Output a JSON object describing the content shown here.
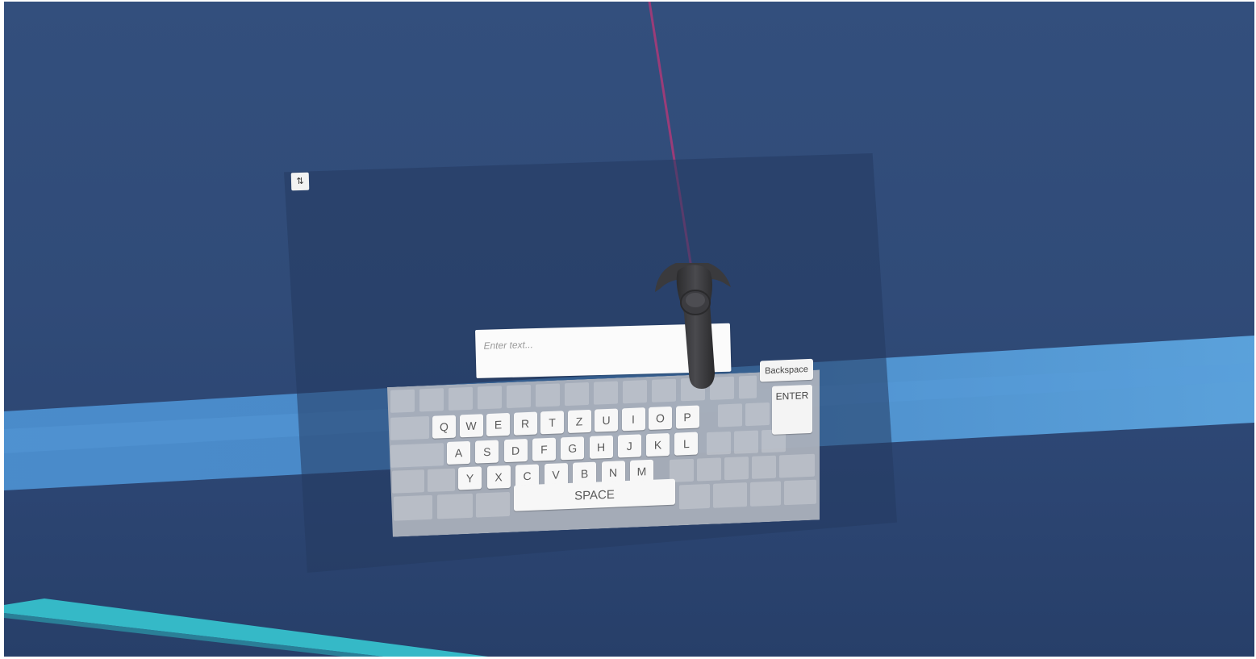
{
  "panel": {
    "sort_icon": "sort-arrows-icon",
    "sort_glyph": "⇅"
  },
  "input": {
    "placeholder": "Enter text...",
    "value": ""
  },
  "keyboard": {
    "row1": [
      "Q",
      "W",
      "E",
      "R",
      "T",
      "Z",
      "U",
      "I",
      "O",
      "P"
    ],
    "row2": [
      "A",
      "S",
      "D",
      "F",
      "G",
      "H",
      "J",
      "K",
      "L"
    ],
    "row3": [
      "Y",
      "X",
      "C",
      "V",
      "B",
      "N",
      "M"
    ],
    "backspace": "Backspace",
    "enter": "ENTER",
    "space": "SPACE"
  },
  "controller": {
    "icon": "vr-controller-icon",
    "laser_color": "#9a3c78"
  },
  "colors": {
    "background": "#334f7d",
    "floor_band": "#4a90d0",
    "floor_edge": "#33b7c4"
  }
}
